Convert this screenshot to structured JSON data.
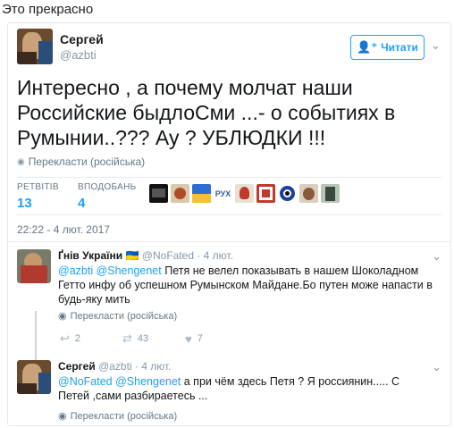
{
  "caption": "Это прекрасно",
  "tweet": {
    "author_name": "Сергей",
    "author_handle": "@azbti",
    "follow_label": "Читати",
    "follow_icon": "add-user-icon",
    "text": "Интересно , а почему молчат наши Российские быдлоСми ...- о событиях в Румынии..???  Ау ? УБЛЮДКИ !!!",
    "translate_label": "Перекласти (російська)",
    "retweets_label": "РЕТВІТІВ",
    "retweets_count": "13",
    "likes_label": "ВПОДОБАНЬ",
    "likes_count": "4",
    "timestamp": "22:22 - 4 лют. 2017"
  },
  "replies": [
    {
      "name": "Ґнів України",
      "flag": "🇺🇦",
      "handle": "@NoFated · 4 лют.",
      "mentions": "@azbti @Shengenet",
      "text": " Петя не велел показывать в нашем Шоколадном Гетто инфу об успешном Румынском Майдане.Бо путен може напасти в будь-яку мить",
      "translate_label": "Перекласти (російська)",
      "reply_count": "2",
      "retweet_count": "43",
      "like_count": "7"
    },
    {
      "name": "Сергей",
      "handle": "@azbti · 4 лют.",
      "mentions": "@NoFated @Shengenet",
      "text": " а при чём здесь Петя ? Я россиянин..... С Петей ,сами разбираетесь ...",
      "translate_label": "Перекласти (російська)"
    }
  ],
  "colors": {
    "accent": "#1da1f2",
    "muted": "#657786",
    "border": "#e1e8ed"
  }
}
